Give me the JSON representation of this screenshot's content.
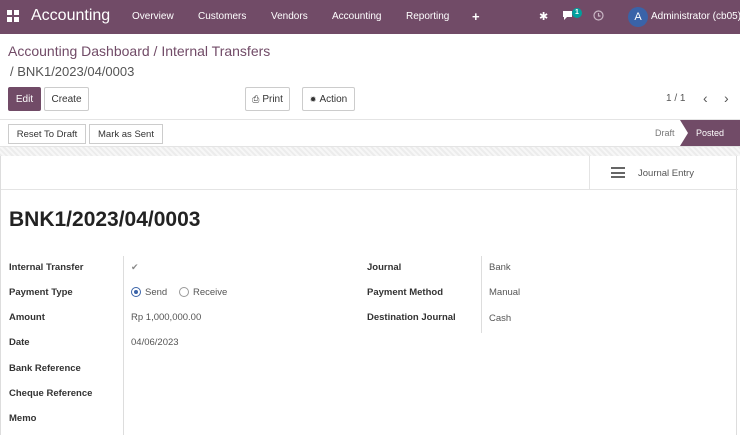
{
  "navbar": {
    "app_title": "Accounting",
    "menu": [
      "Overview",
      "Customers",
      "Vendors",
      "Accounting",
      "Reporting"
    ],
    "message_count": "1",
    "user_initial": "A",
    "user_name": "Administrator (cb05)",
    "color": "#714b67"
  },
  "breadcrumb": {
    "parent": "Accounting Dashboard",
    "middle": "Internal Transfers",
    "current": "BNK1/2023/04/0003"
  },
  "actions": {
    "edit": "Edit",
    "create": "Create",
    "print": "Print",
    "action": "Action"
  },
  "pager": {
    "value": "1 / 1"
  },
  "statusbar": {
    "reset": "Reset To Draft",
    "mark_sent": "Mark as Sent",
    "stage_draft": "Draft",
    "stage_posted": "Posted"
  },
  "smart_button": {
    "label": "Journal Entry"
  },
  "record": {
    "title": "BNK1/2023/04/0003",
    "left_fields": {
      "internal_transfer": "Internal Transfer",
      "payment_type": "Payment Type",
      "amount": "Amount",
      "date": "Date",
      "bank_reference": "Bank Reference",
      "cheque_reference": "Cheque Reference",
      "memo": "Memo"
    },
    "payment_type_options": [
      "Send",
      "Receive"
    ],
    "amount_value": "Rp 1,000,000.00",
    "date_value": "04/06/2023",
    "right_fields": {
      "journal": "Journal",
      "payment_method": "Payment Method",
      "destination_journal": "Destination Journal"
    },
    "journal_value": "Bank",
    "payment_method_value": "Manual",
    "destination_journal_value": "Cash"
  }
}
